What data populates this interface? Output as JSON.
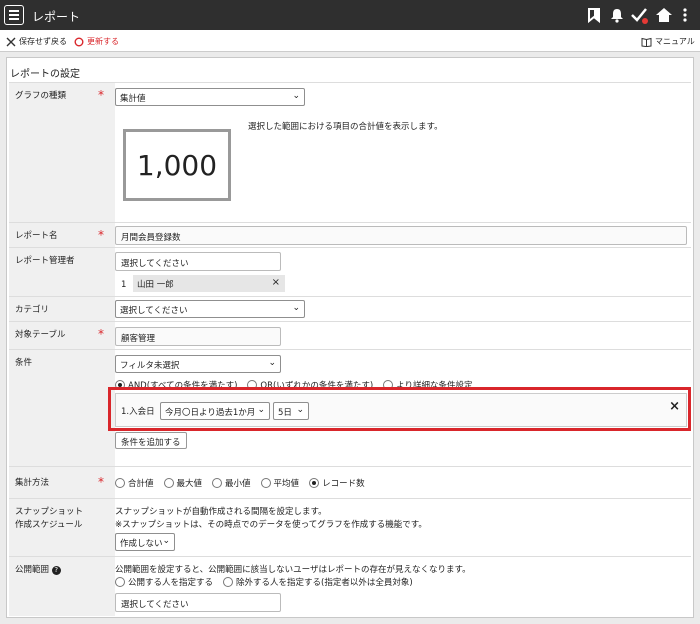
{
  "header": {
    "title": "レポート"
  },
  "toolbar": {
    "discard": "保存せず戻る",
    "update": "更新する",
    "manual": "マニュアル"
  },
  "panel": {
    "title": "レポートの設定"
  },
  "graph": {
    "label": "グラフの種類",
    "selected": "集計値",
    "description": "選択した範囲における項目の合計値を表示します。",
    "preview_value": "1,000"
  },
  "report_name": {
    "label": "レポート名",
    "value": "月間会員登録数"
  },
  "manager": {
    "label": "レポート管理者",
    "placeholder": "選択してください",
    "index": "1",
    "name": "山田 一郎"
  },
  "category": {
    "label": "カテゴリ",
    "selected": "選択してください"
  },
  "table": {
    "label": "対象テーブル",
    "value": "顧客管理"
  },
  "condition": {
    "label": "条件",
    "filter": "フィルタ未選択",
    "and": "AND(すべての条件を満たす)",
    "or": "OR(いずれかの条件を満たす)",
    "detail": "より詳細な条件設定",
    "item_label": "1.入会日",
    "item_range": "今月〇日より過去1か月",
    "item_day": "5日",
    "add": "条件を追加する"
  },
  "aggregation": {
    "label": "集計方法",
    "options": [
      "合計値",
      "最大値",
      "最小値",
      "平均値",
      "レコード数"
    ],
    "selected": "レコード数"
  },
  "snapshot": {
    "label1": "スナップショット",
    "label2": "作成スケジュール",
    "desc1": "スナップショットが自動作成される間隔を設定します。",
    "desc2": "※スナップショットは、その時点でのデータを使ってグラフを作成する機能です。",
    "selected": "作成しない"
  },
  "public": {
    "label": "公開範囲",
    "desc": "公開範囲を設定すると、公開範囲に該当しないユーザはレポートの存在が見えなくなります。",
    "opt1": "公開する人を指定する",
    "opt2": "除外する人を指定する(指定者以外は全員対象)",
    "placeholder": "選択してください"
  },
  "colors": {
    "topbar": "#2f2f2f",
    "accent_red": "#d9262b",
    "label_bg": "#f0f0f0"
  }
}
